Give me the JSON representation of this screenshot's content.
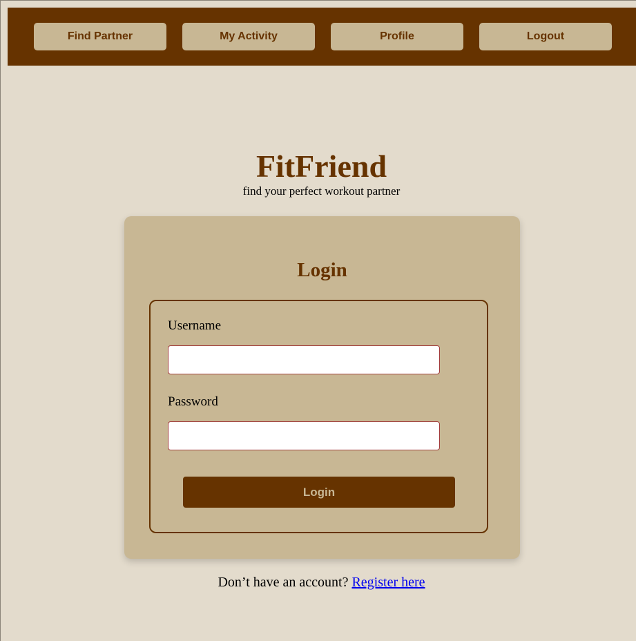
{
  "navbar": {
    "items": [
      {
        "label": "Find Partner"
      },
      {
        "label": "My Activity"
      },
      {
        "label": "Profile"
      },
      {
        "label": "Logout"
      }
    ]
  },
  "header": {
    "title": "FitFriend",
    "subtitle": "find your perfect workout partner"
  },
  "login_card": {
    "title": "Login",
    "username_label": "Username",
    "username_value": "",
    "password_label": "Password",
    "password_value": "",
    "submit_label": "Login"
  },
  "footer": {
    "prompt": "Don’t have an account?",
    "link_label": "Register here"
  },
  "colors": {
    "page_background": "#e3dbcc",
    "brand_brown": "#663300",
    "tan": "#c8b794",
    "link_blue": "#0000ee",
    "input_border": "#a13a3a"
  }
}
